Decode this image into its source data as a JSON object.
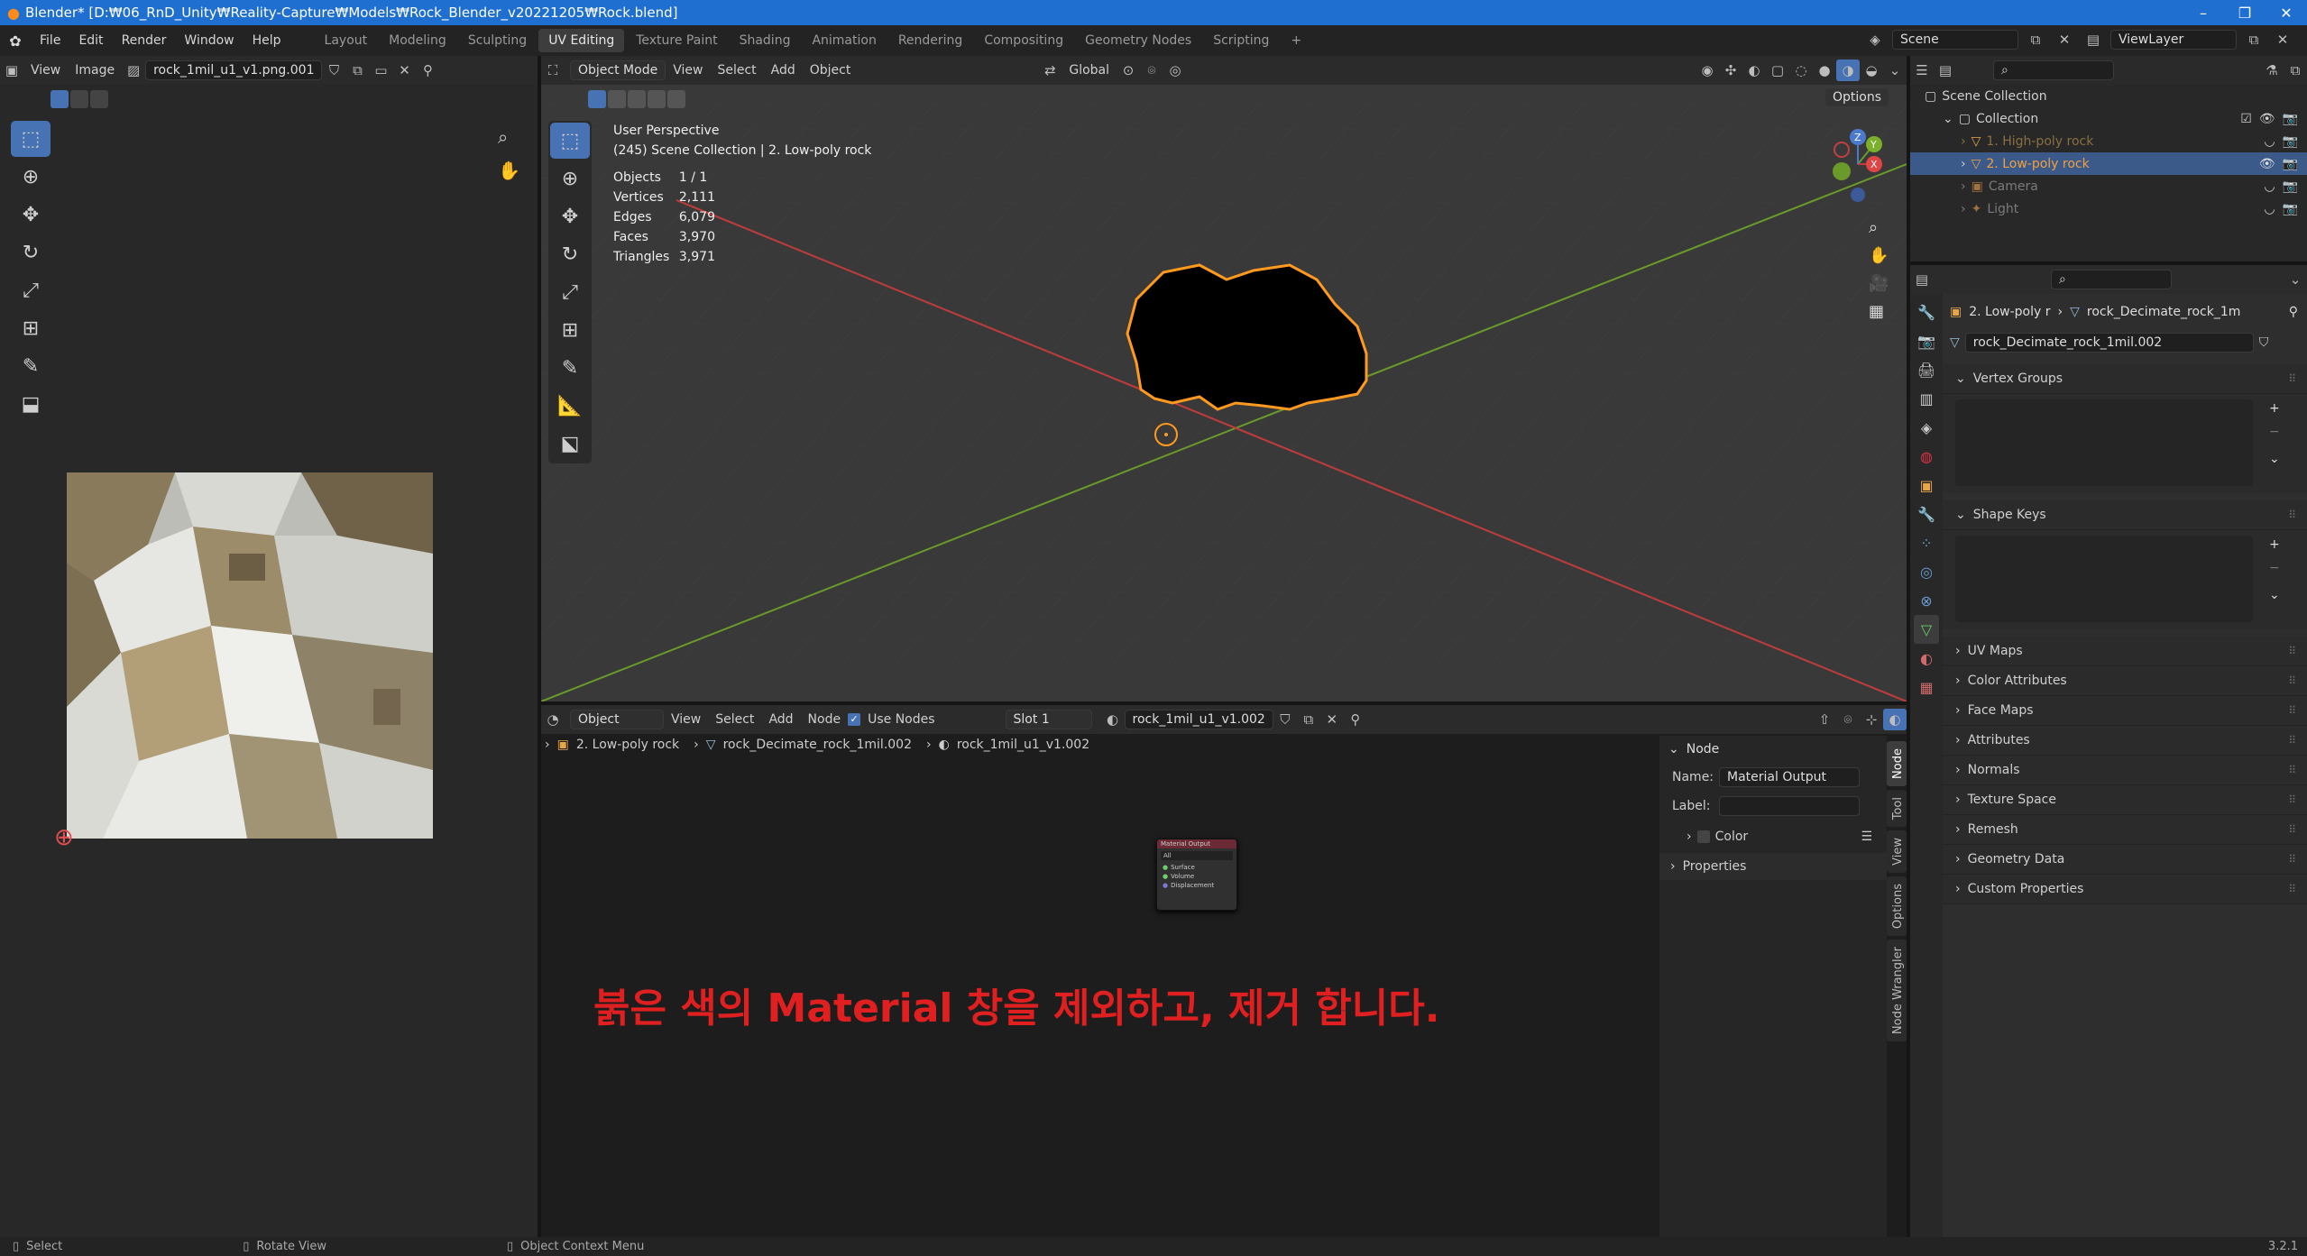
{
  "titlebar": {
    "title": "Blender* [D:₩06_RnD_Unity₩Reality-Capture₩Models₩Rock_Blender_v20221205₩Rock.blend]",
    "minimize": "–",
    "restore": "❐",
    "close": "✕"
  },
  "menu": [
    "File",
    "Edit",
    "Render",
    "Window",
    "Help"
  ],
  "workspaces": [
    "Layout",
    "Modeling",
    "Sculpting",
    "UV Editing",
    "Texture Paint",
    "Shading",
    "Animation",
    "Rendering",
    "Compositing",
    "Geometry Nodes",
    "Scripting"
  ],
  "workspace_add": "+",
  "scene": {
    "label": "Scene",
    "viewlayer": "ViewLayer"
  },
  "image_editor": {
    "view": "View",
    "image": "Image",
    "image_name": "rock_1mil_u1_v1.png.001"
  },
  "viewport": {
    "mode": "Object Mode",
    "menus": [
      "View",
      "Select",
      "Add",
      "Object"
    ],
    "transform": "Global",
    "options": "Options",
    "perspective": "User Perspective",
    "collection_line": "(245) Scene Collection | 2. Low-poly rock",
    "stats": [
      {
        "label": "Objects",
        "value": "1 / 1"
      },
      {
        "label": "Vertices",
        "value": "2,111"
      },
      {
        "label": "Edges",
        "value": "6,079"
      },
      {
        "label": "Faces",
        "value": "3,970"
      },
      {
        "label": "Triangles",
        "value": "3,971"
      }
    ],
    "gizmo": {
      "x": "X",
      "y": "Y",
      "z": "Z"
    }
  },
  "node_editor": {
    "type": "Object",
    "menus": [
      "View",
      "Select",
      "Add",
      "Node"
    ],
    "use_nodes": "Use Nodes",
    "slot": "Slot 1",
    "material": "rock_1mil_u1_v1.002",
    "breadcrumb": [
      "2. Low-poly rock",
      "rock_Decimate_rock_1mil.002",
      "rock_1mil_u1_v1.002"
    ],
    "node_title": "Material Output",
    "node_target": "All",
    "node_sockets": [
      "Surface",
      "Volume",
      "Displacement"
    ],
    "annotation": "붉은 색의 Material 창을 제외하고, 제거 합니다."
  },
  "node_sidebar": {
    "header": "Node",
    "name_label": "Name:",
    "name_value": "Material Output",
    "label_label": "Label:",
    "color": "Color",
    "properties": "Properties",
    "tabs": [
      "Node",
      "Tool",
      "View",
      "Options",
      "Node Wrangler"
    ]
  },
  "outliner": {
    "scene_collection": "Scene Collection",
    "collection": "Collection",
    "items": [
      "1. High-poly rock",
      "2. Low-poly rock",
      "Camera",
      "Light"
    ]
  },
  "properties": {
    "object_crumb": "2. Low-poly r",
    "mesh_crumb": "rock_Decimate_rock_1m",
    "mesh_name": "rock_Decimate_rock_1mil.002",
    "vertex_groups": "Vertex Groups",
    "shape_keys": "Shape Keys",
    "panels": [
      "UV Maps",
      "Color Attributes",
      "Face Maps",
      "Attributes",
      "Normals",
      "Texture Space",
      "Remesh",
      "Geometry Data",
      "Custom Properties"
    ]
  },
  "statusbar": {
    "select": "Select",
    "rotate": "Rotate View",
    "context": "Object Context Menu",
    "version": "3.2.1"
  },
  "colors": {
    "accent": "#4772b3",
    "selected_outline": "#ff9a1f",
    "annotation_red": "#e02020",
    "x_axis": "#c03c3c",
    "y_axis": "#6a9a2a"
  }
}
